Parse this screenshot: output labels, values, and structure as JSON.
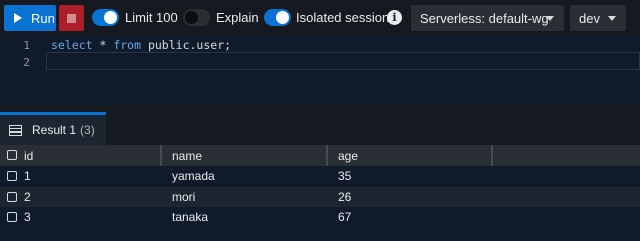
{
  "toolbar": {
    "run_label": "Run",
    "limit_label": "Limit 100",
    "limit_on": true,
    "explain_label": "Explain",
    "explain_on": false,
    "isolated_label": "Isolated session",
    "isolated_on": true,
    "workgroup_value": "Serverless: default-wg",
    "database_value": "dev",
    "icons": {
      "run": "play-icon",
      "stop": "stop-icon",
      "info": "info-icon",
      "dropdown": "chevron-down-icon"
    }
  },
  "editor": {
    "lines": [
      {
        "number": "1",
        "keyword1": "select",
        "rest1": " * ",
        "keyword2": "from",
        "rest2": " public.user;"
      },
      {
        "number": "2",
        "text": ""
      }
    ]
  },
  "results": {
    "tab_label": "Result 1",
    "tab_count": "(3)",
    "columns": [
      "id",
      "name",
      "age"
    ],
    "rows": [
      [
        "1",
        "yamada",
        "35"
      ],
      [
        "2",
        "mori",
        "26"
      ],
      [
        "3",
        "tanaka",
        "67"
      ]
    ]
  },
  "colors": {
    "accent": "#0972d3",
    "stop": "#aa1f2a",
    "background": "#0f1b2a"
  }
}
